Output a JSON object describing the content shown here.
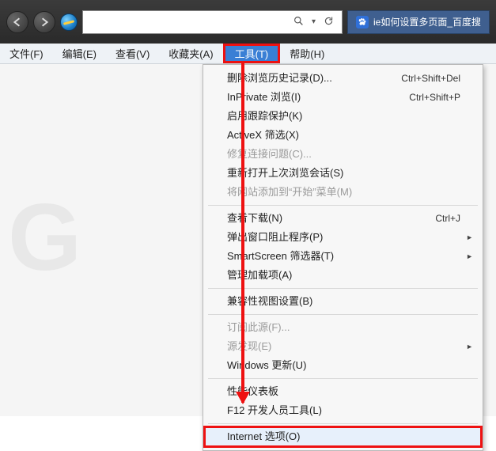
{
  "nav": {
    "address_value": "",
    "tab_title": "ie如何设置多页面_百度搜"
  },
  "menubar": {
    "items": [
      "文件(F)",
      "编辑(E)",
      "查看(V)",
      "收藏夹(A)",
      "工具(T)",
      "帮助(H)"
    ],
    "active_index": 4
  },
  "dropdown": {
    "groups": [
      [
        {
          "label": "删除浏览历史记录(D)...",
          "accel": "Ctrl+Shift+Del"
        },
        {
          "label": "InPrivate 浏览(I)",
          "accel": "Ctrl+Shift+P"
        },
        {
          "label": "启用跟踪保护(K)"
        },
        {
          "label": "ActiveX 筛选(X)"
        },
        {
          "label": "修复连接问题(C)...",
          "disabled": true
        },
        {
          "label": "重新打开上次浏览会话(S)"
        },
        {
          "label": "将网站添加到“开始”菜单(M)",
          "disabled": true
        }
      ],
      [
        {
          "label": "查看下载(N)",
          "accel": "Ctrl+J"
        },
        {
          "label": "弹出窗口阻止程序(P)",
          "submenu": true
        },
        {
          "label": "SmartScreen 筛选器(T)",
          "submenu": true
        },
        {
          "label": "管理加载项(A)"
        }
      ],
      [
        {
          "label": "兼容性视图设置(B)"
        }
      ],
      [
        {
          "label": "订阅此源(F)...",
          "disabled": true
        },
        {
          "label": "源发现(E)",
          "disabled": true,
          "submenu": true
        },
        {
          "label": "Windows 更新(U)"
        }
      ],
      [
        {
          "label": "性能仪表板"
        },
        {
          "label": "F12 开发人员工具(L)"
        }
      ],
      [
        {
          "label": "Internet 选项(O)",
          "highlight": true,
          "redbox": true
        }
      ]
    ]
  }
}
